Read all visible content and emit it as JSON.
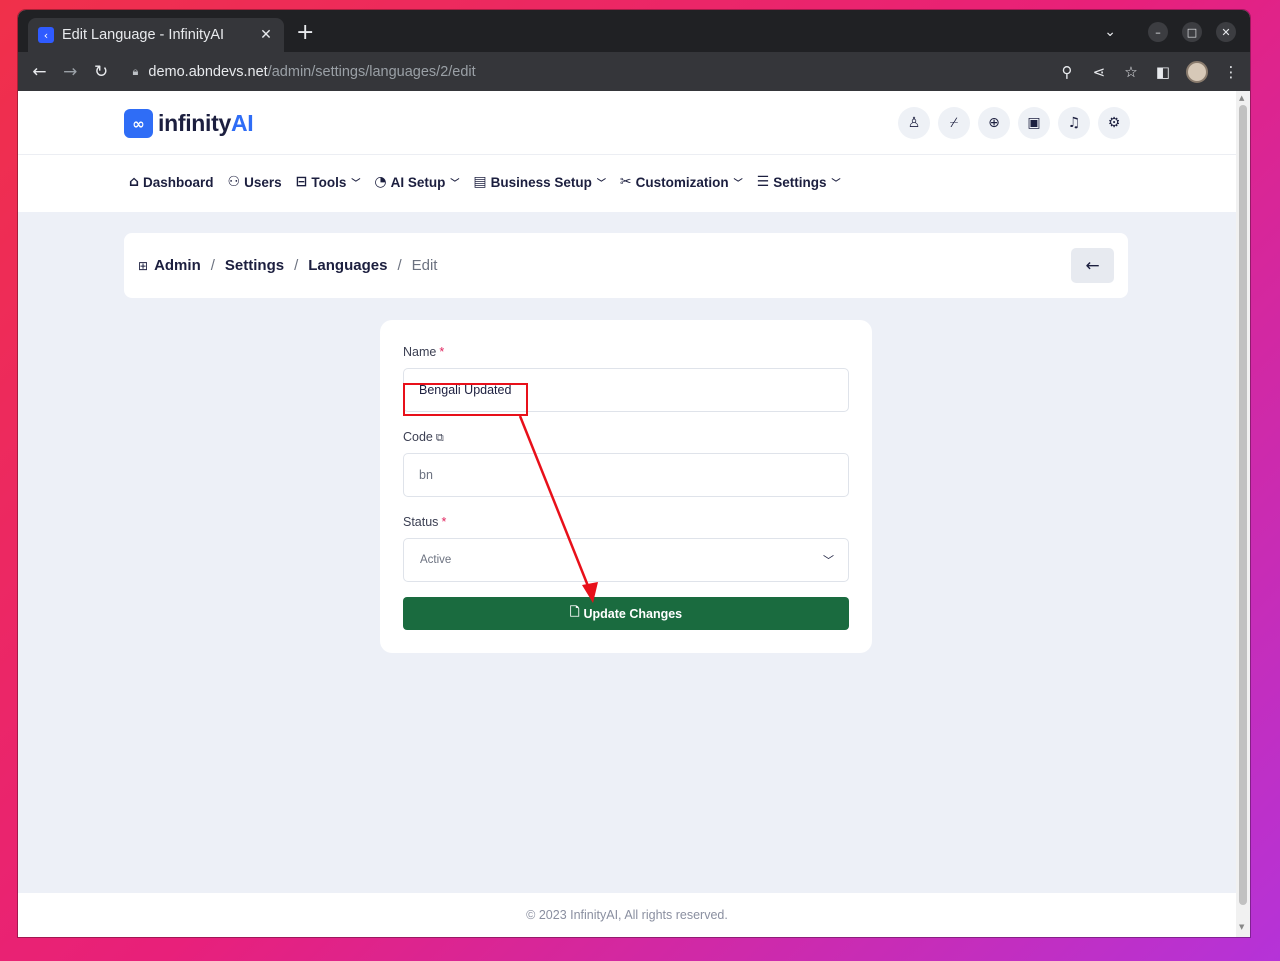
{
  "browser": {
    "tab_title": "Edit Language - InfinityAI",
    "tab_close": "✕",
    "new_tab": "+",
    "url_host": "demo.abndevs.net",
    "url_path": "/admin/settings/languages/2/edit"
  },
  "header": {
    "logo_mark": "∞",
    "logo_text_main": "infinity",
    "logo_text_accent": "AI",
    "icons": [
      "user-icon",
      "broom-icon",
      "globe-icon",
      "id-card-icon",
      "bell-icon",
      "user-settings-icon"
    ]
  },
  "nav": {
    "items": [
      {
        "label": "Dashboard",
        "icon": "home-icon",
        "dropdown": false
      },
      {
        "label": "Users",
        "icon": "users-icon",
        "dropdown": false
      },
      {
        "label": "Tools",
        "icon": "toolbox-icon",
        "dropdown": true
      },
      {
        "label": "AI Setup",
        "icon": "gauge-icon",
        "dropdown": true
      },
      {
        "label": "Business Setup",
        "icon": "building-icon",
        "dropdown": true
      },
      {
        "label": "Customization",
        "icon": "tools-icon",
        "dropdown": true
      },
      {
        "label": "Settings",
        "icon": "sliders-icon",
        "dropdown": true
      }
    ]
  },
  "breadcrumb": {
    "admin": "Admin",
    "settings": "Settings",
    "languages": "Languages",
    "current": "Edit",
    "separator": "/",
    "back": "←"
  },
  "form": {
    "name_label": "Name",
    "name_value": "Bengali Updated",
    "code_label": "Code",
    "code_placeholder": "bn",
    "status_label": "Status",
    "status_value": "Active",
    "required_mark": "*",
    "submit_label": "Update Changes"
  },
  "footer": {
    "text": "© 2023 InfinityAI, All rights reserved."
  },
  "colors": {
    "brand": "#2f6df6",
    "submit": "#1a6b3f",
    "annotation": "#e8101a",
    "page_bg": "#edf0f7"
  }
}
